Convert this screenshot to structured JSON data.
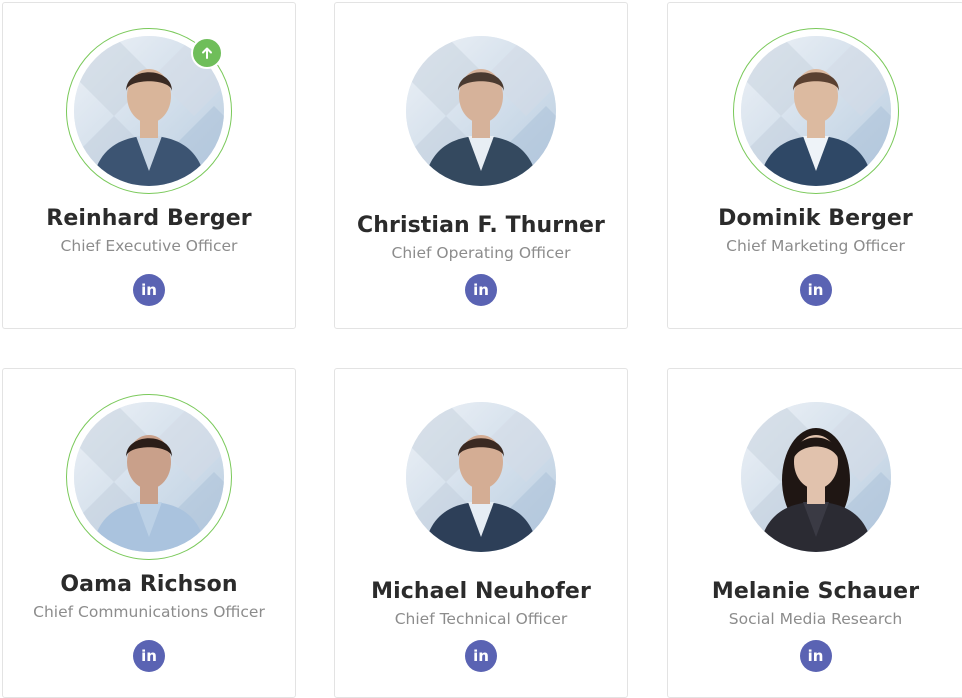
{
  "team": [
    {
      "name": "Reinhard Berger",
      "title": "Chief Executive Officer",
      "social": "linkedin-icon",
      "highlight": true,
      "badge": "arrow-up-icon",
      "skin": "#d9b59a",
      "hair": "#3a2a22",
      "suit": "#3c5472",
      "shirt": "#c9d7e6"
    },
    {
      "name": "Christian F. Thurner",
      "title": "Chief Operating Officer",
      "social": "linkedin-icon",
      "highlight": false,
      "skin": "#d6b29a",
      "hair": "#4a3a30",
      "suit": "#34495f",
      "shirt": "#e8eef4"
    },
    {
      "name": "Dominik Berger",
      "title": "Chief Marketing Officer",
      "social": "linkedin-icon",
      "highlight": true,
      "skin": "#dcbaa0",
      "hair": "#5a4030",
      "suit": "#2f4866",
      "shirt": "#eef3f8"
    },
    {
      "name": "Oama Richson",
      "title": "Chief Communications Officer",
      "social": "linkedin-icon",
      "highlight": true,
      "skin": "#c9a08a",
      "hair": "#2a1d18",
      "suit": "#aac3de",
      "shirt": "#bcd1e6"
    },
    {
      "name": "Michael Neuhofer",
      "title": "Chief Technical Officer",
      "social": "linkedin-icon",
      "highlight": false,
      "skin": "#d4ad94",
      "hair": "#3b2a22",
      "suit": "#2d3f58",
      "shirt": "#e6edf4"
    },
    {
      "name": "Melanie Schauer",
      "title": "Social Media Research",
      "social": "linkedin-icon",
      "highlight": false,
      "skin": "#e1c2ad",
      "hair": "#1f1613",
      "suit": "#2b2b33",
      "shirt": "#3a3a44"
    }
  ],
  "colors": {
    "ring": "#7ac95a",
    "badge": "#6fbe5a",
    "linkedin": "#5a63b3",
    "name": "#2b2b2b",
    "title": "#8c8c8c"
  }
}
